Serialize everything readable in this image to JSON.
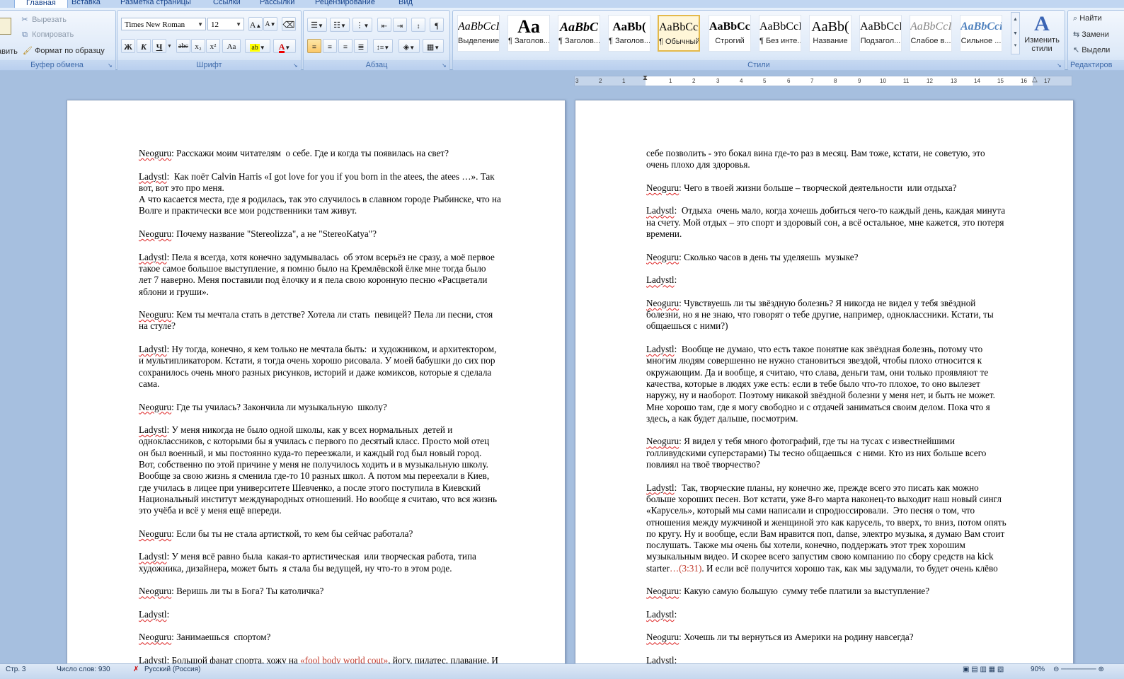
{
  "tabs": [
    "Главная",
    "Вставка",
    "Разметка страницы",
    "Ссылки",
    "Рассылки",
    "Рецензирование",
    "Вид"
  ],
  "clipboard": {
    "paste_label": "авить",
    "cut": "Вырезать",
    "copy": "Копировать",
    "format_painter": "Формат по образцу",
    "group_label": "Буфер обмена"
  },
  "font": {
    "name": "Times New Roman",
    "size": "12",
    "group_label": "Шрифт",
    "bold": "Ж",
    "italic": "К",
    "underline": "Ч",
    "strike": "abc",
    "subscript": "x₂",
    "superscript": "x²",
    "change_case": "Aa",
    "grow": "A",
    "shrink": "A"
  },
  "paragraph": {
    "group_label": "Абзац"
  },
  "styles": {
    "group_label": "Стили",
    "items": [
      {
        "sample": "AaBbCcI",
        "name": "Выделение"
      },
      {
        "sample": "Aa",
        "name": "¶ Заголов..."
      },
      {
        "sample": "AaBbC",
        "name": "¶ Заголов..."
      },
      {
        "sample": "AaBb(",
        "name": "¶ Заголов..."
      },
      {
        "sample": "AaBbCcI",
        "name": "¶ Обычный"
      },
      {
        "sample": "AaBbCcI",
        "name": "Строгий"
      },
      {
        "sample": "AaBbCcI",
        "name": "¶ Без инте..."
      },
      {
        "sample": "AaBb(",
        "name": "Название"
      },
      {
        "sample": "AaBbCcI",
        "name": "Подзагол..."
      },
      {
        "sample": "AaBbCcI",
        "name": "Слабое в..."
      },
      {
        "sample": "AaBbCci",
        "name": "Сильное ..."
      }
    ],
    "change_styles": "Изменить стили"
  },
  "editing": {
    "find": "Найти",
    "replace": "Замени",
    "select": "Выдели",
    "group_label": "Редактиров"
  },
  "ruler": {
    "left_nums": [
      "3",
      "2",
      "1"
    ],
    "right_nums": [
      "1",
      "2",
      "3",
      "4",
      "5",
      "6",
      "7",
      "8",
      "9",
      "10",
      "11",
      "12",
      "13",
      "14",
      "15",
      "16",
      "17"
    ]
  },
  "page1": [
    [
      "Neoguru",
      ": Расскажи моим читателям  о себе. Где и когда ты появилась на свет?"
    ],
    [
      ""
    ],
    [
      "Ladystl",
      ":  Как поёт Calvin Harris «I got love for you if you born in the atees, the atees …». Так\nвот, вот это про меня.\nА что касается места, где я родилась, так это случилось в славном городе Рыбинске, что на\nВолге и практически все мои родственники там живут."
    ],
    [
      ""
    ],
    [
      "Neoguru",
      ": Почему название \"Stereolizza\", а не \"StereoKatya\"?"
    ],
    [
      ""
    ],
    [
      "Ladystl",
      ": Пела я всегда, хотя конечно задумывалась  об этом всерьёз не сразу, а моё первое\nтакое самое большое выступление, я помню было на Кремлёвской ёлке мне тогда было\nлет 7 наверно. Меня поставили под ёлочку и я пела свою коронную песню «Расцветали\nяблони и груши»."
    ],
    [
      ""
    ],
    [
      "Neoguru",
      ": Кем ты мечтала стать в детстве? Хотела ли стать  певицей? Пела ли песни, стоя\nна стуле?"
    ],
    [
      ""
    ],
    [
      "Ladystl",
      ": Ну тогда, конечно, я кем только не мечтала быть:  и художником, и архитектором,\nи мультипликатором. Кстати, я тогда очень хорошо рисовала. У моей бабушки до сих пор\nсохранилось очень много разных рисунков, историй и даже комиксов, которые я сделала\nсама."
    ],
    [
      ""
    ],
    [
      "Neoguru",
      ": Где ты училась? Закончила ли музыкальную  школу?"
    ],
    [
      ""
    ],
    [
      "Ladystl",
      ": У меня никогда не было одной школы, как у всех нормальных  детей и\nодноклассников, с которыми бы я училась с первого по десятый класс. Просто мой отец\nон был военный, и мы постоянно куда-то переезжали, и каждый год был новый город.\nВот, собственно по этой причине у меня не получилось ходить и в музыкальную школу.\nВообще за свою жизнь я сменила где-то 10 разных школ. А потом мы переехали в Киев,\nгде училась в лицее при университете Шевченко, а после этого поступила в Киевский\nНациональный институт международных отношений. Но вообще я считаю, что вся жизнь\nэто учёба и всё у меня ещё впереди."
    ],
    [
      ""
    ],
    [
      "Neoguru",
      ": Если бы ты не стала артисткой, то кем бы сейчас работала?"
    ],
    [
      ""
    ],
    [
      "Ladystl",
      ": У меня всё равно была  какая-то артистическая  или творческая работа, типа\nхудожника, дизайнера, может быть  я стала бы ведущей, ну что-то в этом роде."
    ],
    [
      ""
    ],
    [
      "Neoguru",
      ": Веришь ли ты в Бога? Ты католичка?"
    ],
    [
      ""
    ],
    [
      "Ladystl",
      ":"
    ],
    [
      ""
    ],
    [
      "Neoguru",
      ": Занимаешься  спортом?"
    ],
    [
      ""
    ],
    [
      "Ladystl",
      ": Большой фанат спорта, хожу на ",
      "«fool body world cout»",
      ", йогу, пилатес, плавание. И"
    ]
  ],
  "page2": [
    [
      "",
      "себе позволить - это бокал вина где-то раз в месяц. Вам тоже, кстати, не советую, это\nочень плохо для здоровья."
    ],
    [
      ""
    ],
    [
      "Neoguru",
      ": Чего в твоей жизни больше – творческой деятельности  или отдыха?"
    ],
    [
      ""
    ],
    [
      "Ladystl",
      ":  Отдыха  очень мало, когда хочешь добиться чего-то каждый день, каждая минута\nна счету. Мой отдых – это спорт и здоровый сон, а всё остальное, мне кажется, это потеря\nвремени."
    ],
    [
      ""
    ],
    [
      "Neoguru",
      ": Сколько часов в день ты уделяешь  музыке?"
    ],
    [
      ""
    ],
    [
      "Ladystl",
      ":"
    ],
    [
      ""
    ],
    [
      "Neoguru",
      ": Чувствуешь ли ты звёздную болезнь? Я никогда не видел у тебя звёздной\nболезни, но я не знаю, что говорят о тебе другие, например, одноклассники. Кстати, ты\nобщаешься с ними?)"
    ],
    [
      ""
    ],
    [
      "Ladystl",
      ":  Вообще не думаю, что есть такое понятие как звёздная болезнь, потому что\nмногим людям совершенно не нужно становиться звездой, чтобы плохо относится к\nокружающим. Да и вообще, я считаю, что слава, деньги там, они только проявляют те\nкачества, которые в людях уже есть: если в тебе было что-то плохое, то оно вылезет\nнаружу, ну и наоборот. Поэтому никакой звёздной болезни у меня нет, и быть не может.\nМне хорошо там, где я могу свободно и с отдачей заниматься своим делом. Пока что я\nздесь, а как будет дальше, посмотрим."
    ],
    [
      ""
    ],
    [
      "Neoguru",
      ": Я видел у тебя много фотографий, где ты на тусах с известнейшими\nголливудскими суперстарами) Ты тесно общаешься  с ними. Кто из них больше всего\nповлиял на твоё творчество?"
    ],
    [
      ""
    ],
    [
      "Ladystl",
      ":  Так, творческие планы, ну конечно же, прежде всего это писать как можно\nбольше хороших песен. Вот кстати, уже 8-го марта наконец-то выходит наш новый сингл\n«Карусель», который мы сами написали и спродюссировали.  Это песня о том, что\nотношения между мужчиной и женщиной это как карусель, то вверх, то вниз, потом опять\nпо кругу. Ну и вообще, если Вам нравится поп, danse, электро музыка, я думаю Вам стоит\nпослушать. Также мы очень бы хотели, конечно, поддержать этот трек хорошим\nмузыкальным видео. И скорее всего запустим свою компанию по сбору средств на kick\nstarter",
      "…(3:31)",
      ". И если всё получится хорошо так, как мы задумали, то будет очень клёво"
    ],
    [
      ""
    ],
    [
      "Neoguru",
      ": Какую самую большую  сумму тебе платили за выступление?"
    ],
    [
      ""
    ],
    [
      "Ladystl",
      ":"
    ],
    [
      ""
    ],
    [
      "Neoguru",
      ": Хочешь ли ты вернуться из Америки на родину навсегда?"
    ],
    [
      ""
    ],
    [
      "Ladystl",
      ":"
    ]
  ],
  "status": {
    "page": "Стр. 3",
    "words": "Число слов: 930",
    "lang": "Русский (Россия)",
    "zoom": "90%"
  }
}
